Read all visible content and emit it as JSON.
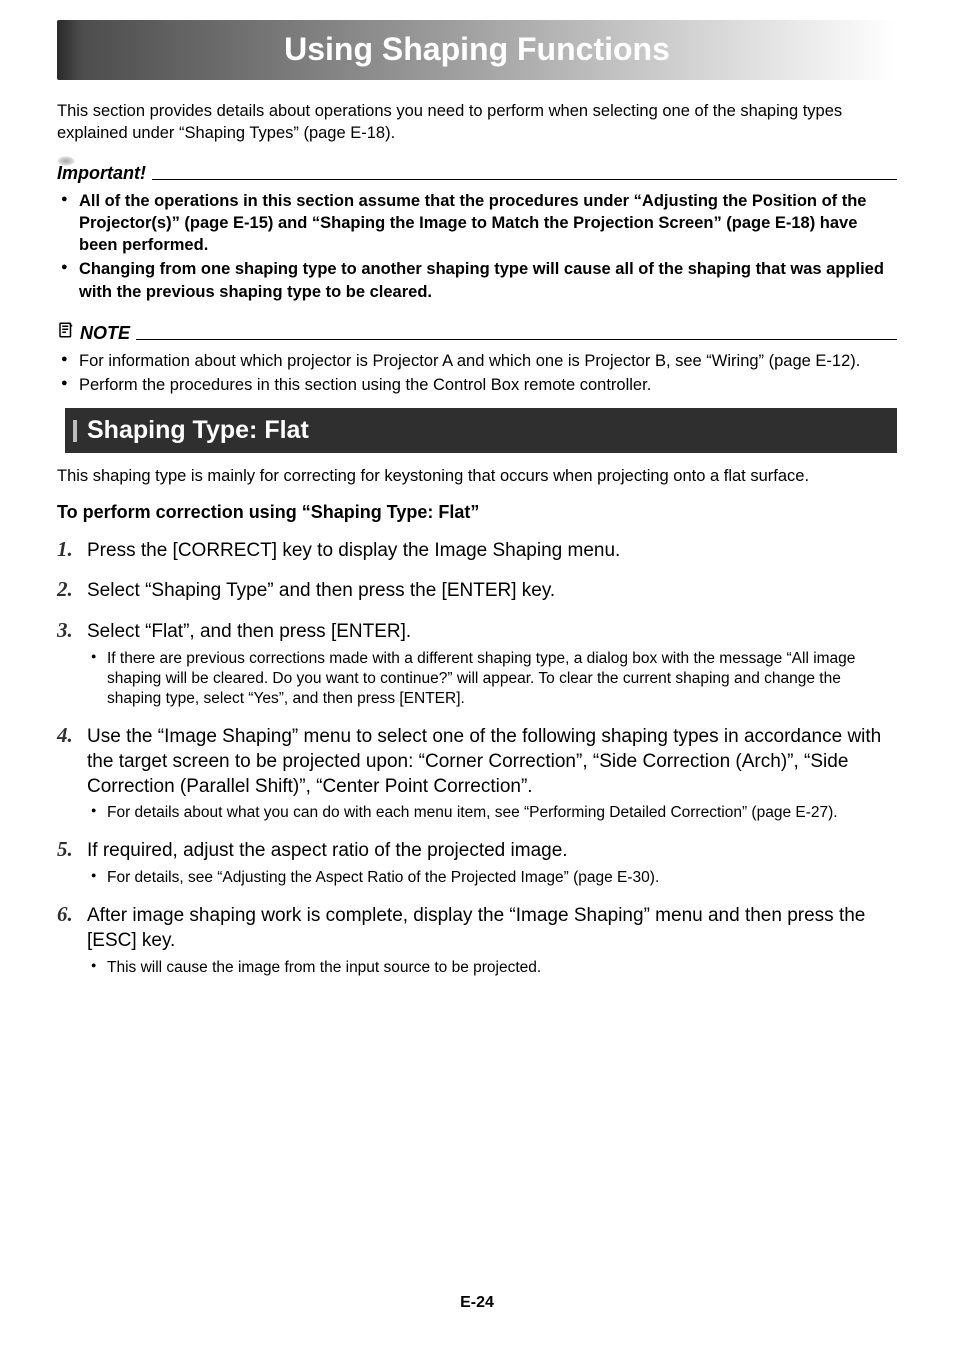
{
  "title": "Using Shaping Functions",
  "intro": "This section provides details about operations you need to perform when selecting one of the shaping types explained under “Shaping Types” (page E-18).",
  "important": {
    "label": "Important!",
    "items": [
      "All of the operations in this section assume that the procedures under “Adjusting the Position of the Projector(s)” (page E-15) and “Shaping the Image to Match the Projection Screen” (page E-18) have been performed.",
      "Changing from one shaping type to another shaping type will cause all of the shaping that was applied with the previous shaping type to be cleared."
    ]
  },
  "note": {
    "label": "NOTE",
    "items": [
      "For information about which projector is Projector A and which one is Projector B, see “Wiring” (page E-12).",
      "Perform the procedures in this section using the Control Box remote controller."
    ]
  },
  "section": {
    "heading": "Shaping Type: Flat",
    "desc": "This shaping type is mainly for correcting for keystoning that occurs when projecting onto a flat surface.",
    "subhead": "To perform correction using “Shaping Type: Flat”",
    "steps": [
      {
        "main": "Press the [CORRECT] key to display the Image Shaping menu.",
        "subs": []
      },
      {
        "main": "Select “Shaping Type” and then press the [ENTER] key.",
        "subs": []
      },
      {
        "main": "Select “Flat”, and then press [ENTER].",
        "subs": [
          "If there are previous corrections made with a different shaping type, a dialog box with the message “All image shaping will be cleared. Do you want to continue?” will appear. To clear the current shaping and change the shaping type, select “Yes”, and then press [ENTER]."
        ]
      },
      {
        "main": "Use the “Image Shaping” menu to select one of the following shaping types in accordance with the target screen to be projected upon: “Corner Correction”, “Side Correction (Arch)”, “Side Correction (Parallel Shift)”, “Center Point Correction”.",
        "subs": [
          "For details about what you can do with each menu item, see “Performing Detailed Correction” (page E-27)."
        ]
      },
      {
        "main": "If required, adjust the aspect ratio of the projected image.",
        "subs": [
          "For details, see “Adjusting the Aspect Ratio of the Projected Image” (page E-30)."
        ]
      },
      {
        "main": "After image shaping work is complete, display the “Image Shaping” menu and then press the [ESC] key.",
        "subs": [
          "This will cause the image from the input source to be projected."
        ]
      }
    ]
  },
  "footer": "E-24"
}
